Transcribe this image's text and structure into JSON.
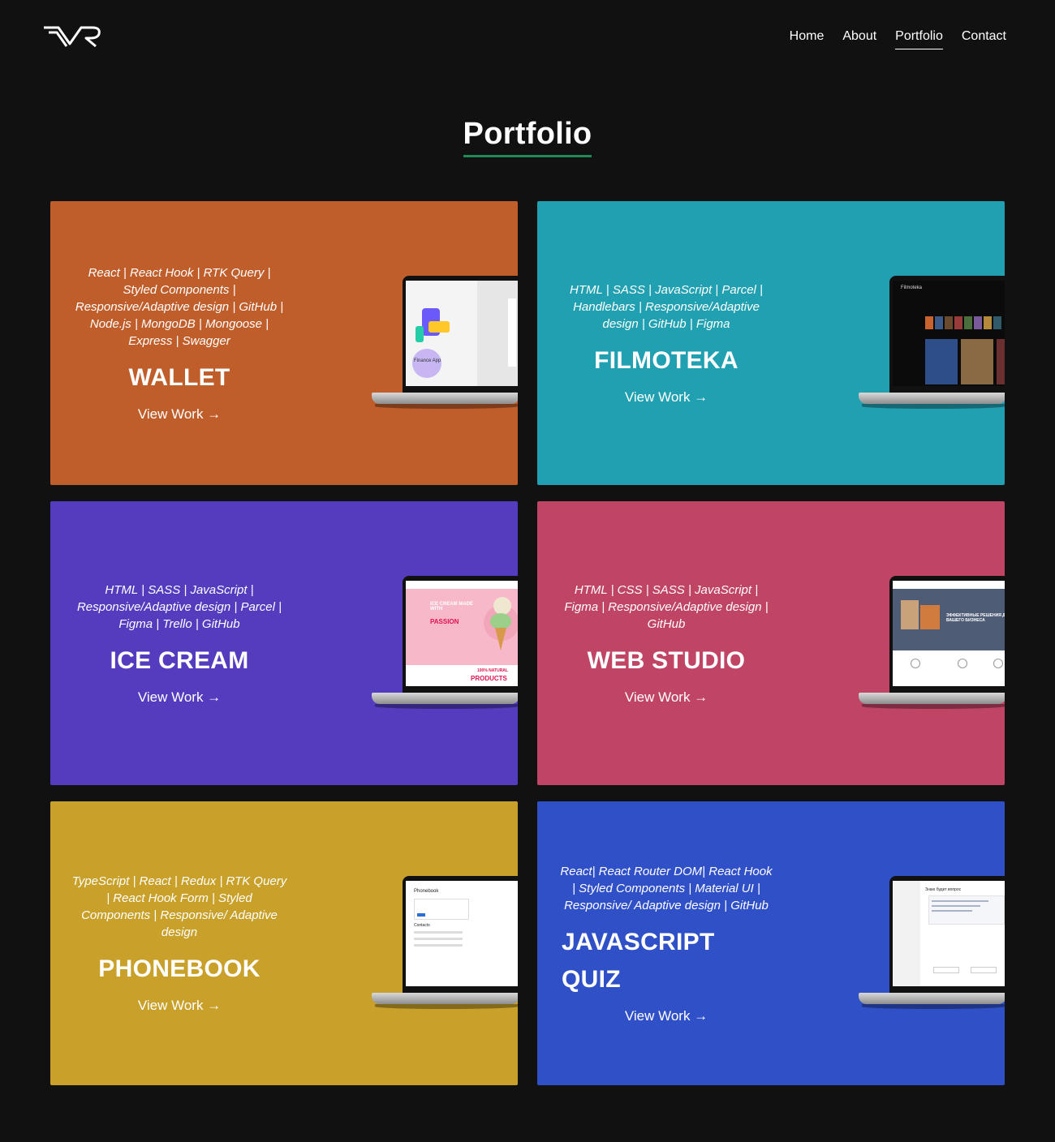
{
  "logo": {
    "text": "VR"
  },
  "nav": {
    "items": [
      {
        "label": "Home",
        "active": false
      },
      {
        "label": "About",
        "active": false
      },
      {
        "label": "Portfolio",
        "active": true
      },
      {
        "label": "Contact",
        "active": false
      }
    ]
  },
  "page": {
    "title": "Portfolio",
    "accent": "#1f8a55",
    "background": "#111111"
  },
  "projects": [
    {
      "tech": "React | React Hook | RTK Query | Styled Components | Responsive/Adaptive design | GitHub | Node.js | MongoDB | Mongoose | Express | Swagger",
      "title": "WALLET",
      "link": "View Work →",
      "color": "#c05e2b",
      "screenshot": "finance-app"
    },
    {
      "tech": "HTML | SASS | JavaScript | Parcel | Handlebars | Responsive/Adaptive design | GitHub | Figma",
      "title": "FILMOTEKA",
      "link": "View Work →",
      "color": "#21a0b2",
      "screenshot": "filmoteka"
    },
    {
      "tech": "HTML | SASS | JavaScript | Responsive/Adaptive design | Parcel | Figma | Trello | GitHub",
      "title": "ICE CREAM",
      "link": "View Work →",
      "color": "#553cbf",
      "screenshot": "ice-cream"
    },
    {
      "tech": "HTML | CSS | SASS | JavaScript | Figma | Responsive/Adaptive design | GitHub",
      "title": "WEB STUDIO",
      "link": "View Work →",
      "color": "#c04564",
      "screenshot": "web-studio"
    },
    {
      "tech": "TypeScript | React | Redux | RTK Query | React Hook Form | Styled Components | Responsive/ Adaptive design",
      "title": "PHONEBOOK",
      "link": "View Work →",
      "color": "#c9a12a",
      "screenshot": "phonebook"
    },
    {
      "tech": "React| React Router DOM| React Hook | Styled Components | Material UI | Responsive/ Adaptive design | GitHub",
      "title": "JAVASCRIPT QUIZ",
      "link": "View Work →",
      "color": "#3050c8",
      "screenshot": "js-quiz"
    }
  ],
  "screens": {
    "finance": "Finance App",
    "filmoteka": "Filmoteka",
    "icecream_headline": "ICE CREAM MADE WITH",
    "icecream_passion": "PASSION",
    "icecream_natural": "100% NATURAL",
    "icecream_products": "PRODUCTS",
    "studio_headline": "ЭФФЕКТИВНЫЕ РЕШЕНИЯ ДЛЯ ВАШЕГО БИЗНЕСА",
    "phonebook": "Phonebook",
    "contacts": "Contacts",
    "quiz": "Знаю будет вопрос"
  }
}
